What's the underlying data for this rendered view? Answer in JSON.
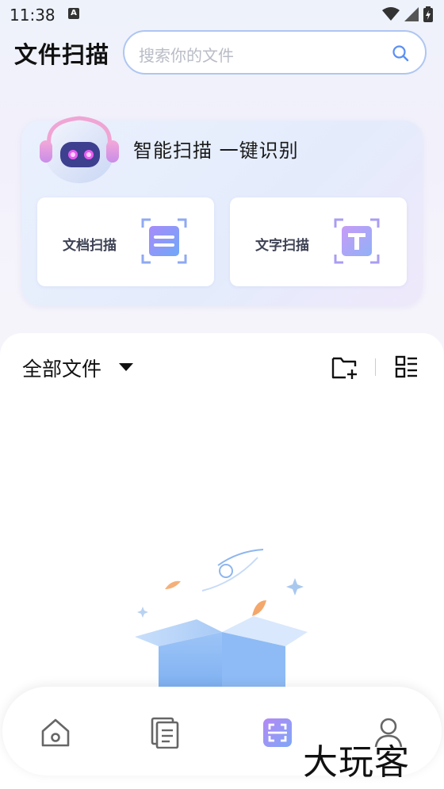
{
  "status_bar": {
    "time": "11:38",
    "notification_letter": "A"
  },
  "header": {
    "title": "文件扫描",
    "search_placeholder": "搜索你的文件"
  },
  "scan_card": {
    "slogan": "智能扫描  一键识别",
    "tiles": [
      {
        "label": "文档扫描",
        "icon": "document-scan-icon"
      },
      {
        "label": "文字扫描",
        "icon": "text-scan-icon"
      }
    ]
  },
  "files": {
    "filter_label": "全部文件"
  },
  "bottom_nav": {
    "items": [
      "home-icon",
      "files-icon",
      "scan-icon",
      "profile-icon"
    ],
    "active": "scan-icon"
  },
  "watermark": "大玩客",
  "colors": {
    "accent_blue": "#5b8ff5",
    "accent_purple": "#9b7cf6",
    "search_border": "#aec6f2"
  }
}
